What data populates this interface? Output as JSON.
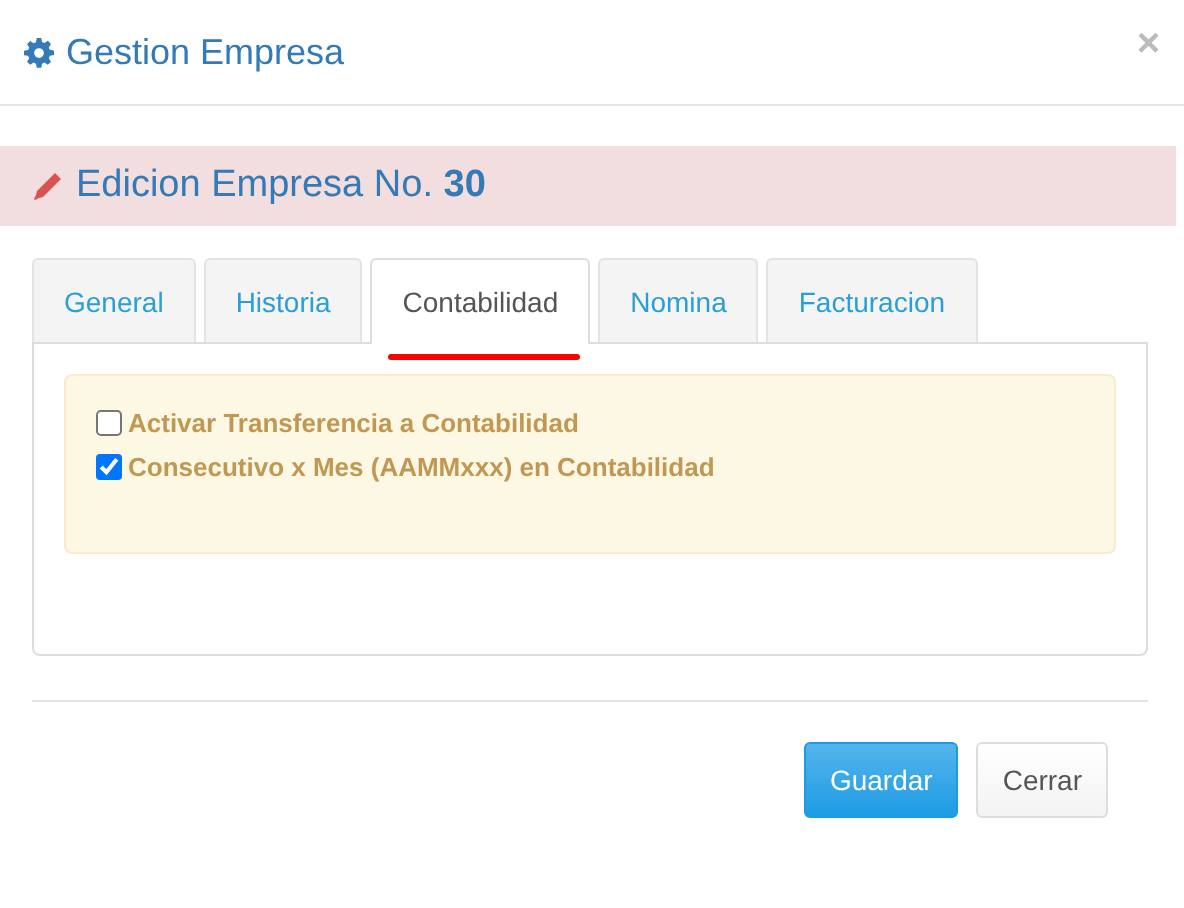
{
  "dialog": {
    "title": "Gestion Empresa",
    "close": "×"
  },
  "banner": {
    "text": "Edicion Empresa No. **30**"
  },
  "tabs": [
    {
      "label": "General",
      "selected": false
    },
    {
      "label": "Historia",
      "selected": false
    },
    {
      "label": "Contabilidad",
      "selected": true
    },
    {
      "label": "Nomina",
      "selected": false
    },
    {
      "label": "Facturacion",
      "selected": false
    }
  ],
  "options": [
    {
      "label": "Activar Transferencia a Contabilidad",
      "checked": false
    },
    {
      "label": "Consecutivo x Mes (AAMMxxx) en Contabilidad",
      "checked": true
    }
  ],
  "buttons": [
    {
      "label": "Guardar",
      "kind": "primary"
    },
    {
      "label": "Cerrar",
      "kind": "default"
    }
  ]
}
